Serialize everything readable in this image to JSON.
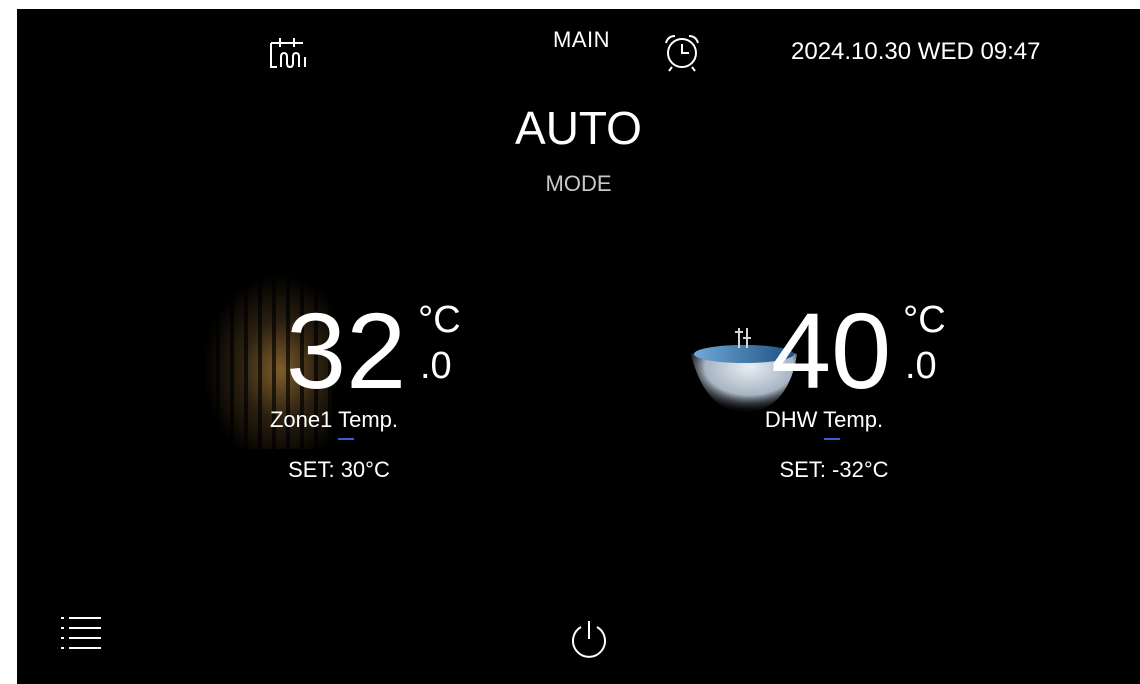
{
  "header": {
    "title": "MAIN",
    "datetime": "2024.10.30 WED 09:47",
    "left_icon": "heating-schedule-icon",
    "alarm_icon": "alarm-clock-icon"
  },
  "mode": {
    "value": "AUTO",
    "label": "MODE"
  },
  "zones": [
    {
      "integer": "32",
      "decimal": ".0",
      "unit": "°C",
      "label": "Zone1 Temp.",
      "set": "SET: 30°C",
      "background": "forest"
    },
    {
      "integer": "40",
      "decimal": ".0",
      "unit": "°C",
      "label": "DHW Temp.",
      "set": "SET: -32°C",
      "background": "bathtub"
    }
  ],
  "footer": {
    "menu_icon": "menu-list-icon",
    "power_icon": "power-icon"
  },
  "colors": {
    "background": "#000000",
    "text": "#ffffff",
    "accent": "#3b5bdb"
  }
}
